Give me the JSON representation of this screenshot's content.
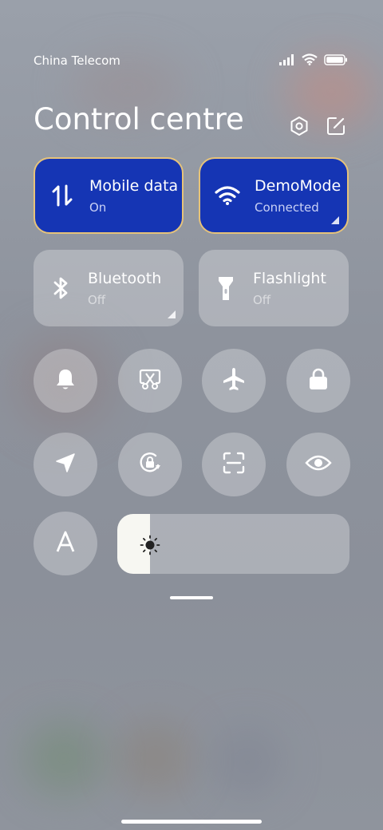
{
  "status": {
    "carrier": "China Telecom",
    "icons": [
      "signal-icon",
      "wifi-icon",
      "battery-icon"
    ]
  },
  "header": {
    "title": "Control centre",
    "actions": [
      "settings-icon",
      "edit-icon"
    ]
  },
  "tiles": [
    {
      "id": "mobile-data",
      "label": "Mobile data",
      "state": "On",
      "active": true,
      "icon": "data-arrows-icon"
    },
    {
      "id": "wifi",
      "label": "DemoMode",
      "state": "Connected",
      "active": true,
      "icon": "wifi-icon"
    },
    {
      "id": "bluetooth",
      "label": "Bluetooth",
      "state": "Off",
      "active": false,
      "icon": "bluetooth-icon"
    },
    {
      "id": "flashlight",
      "label": "Flashlight",
      "state": "Off",
      "active": false,
      "icon": "flashlight-icon"
    }
  ],
  "toggles": [
    "bell-icon",
    "screenshot-icon",
    "airplane-icon",
    "lock-icon",
    "location-icon",
    "rotation-lock-icon",
    "scanner-icon",
    "eye-icon",
    "auto-brightness-icon"
  ],
  "brightness": {
    "level": 0.14,
    "icon": "sun-icon"
  },
  "colors": {
    "active_tile": "#1535b4",
    "active_border": "#e6c37a"
  }
}
